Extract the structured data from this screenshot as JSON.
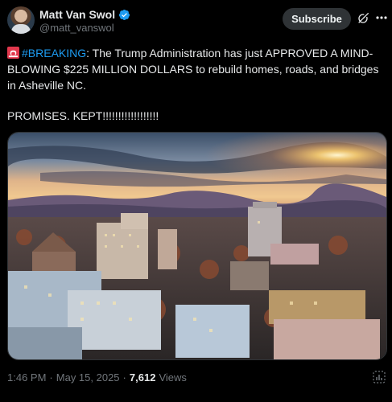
{
  "author": {
    "display_name": "Matt Van Swol",
    "handle": "@matt_vanswol"
  },
  "actions": {
    "subscribe_label": "Subscribe"
  },
  "tweet": {
    "hashtag": "#BREAKING",
    "body": ": The Trump Administration has just APPROVED A MIND-BLOWING $225 MILLION DOLLARS to rebuild homes, roads, and bridges in Asheville NC.",
    "line2": "PROMISES. KEPT!!!!!!!!!!!!!!!!!!"
  },
  "meta": {
    "time": "1:46 PM",
    "dot1": "·",
    "date": "May 15, 2025",
    "dot2": "·",
    "views_count": "7,612",
    "views_label": "Views"
  },
  "colors": {
    "accent": "#1d9bf0",
    "background": "#000000",
    "muted": "#71767b"
  },
  "icons": [
    "verified-badge-icon",
    "grok-icon",
    "more-icon",
    "siren-emoji-icon",
    "view-stats-icon"
  ]
}
